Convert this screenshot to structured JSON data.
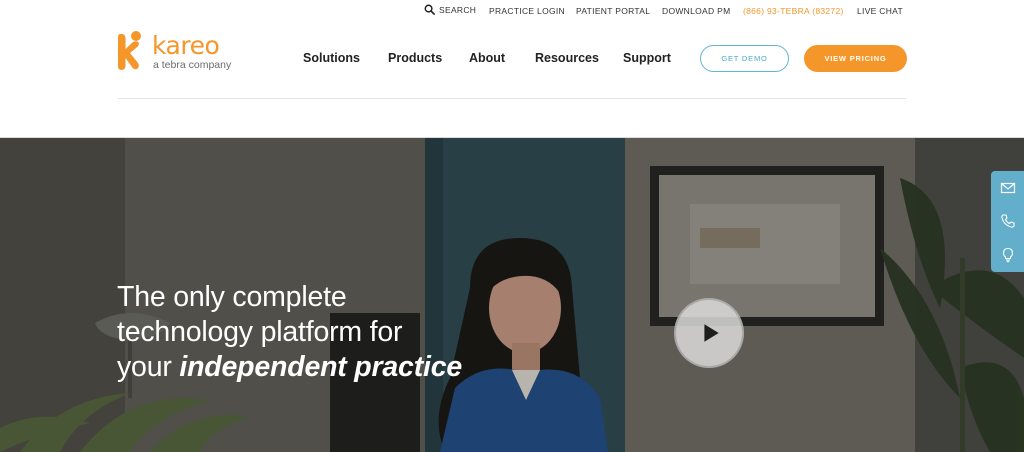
{
  "utility_bar": {
    "search": "SEARCH",
    "practice_login": "PRACTICE LOGIN",
    "patient_portal": "PATIENT PORTAL",
    "download_pm": "DOWNLOAD PM",
    "phone": "(866) 93-TEBRA (83272)",
    "live_chat": "LIVE CHAT"
  },
  "logo": {
    "wordmark": "kareo",
    "tagline": "a tebra company"
  },
  "nav": {
    "items": [
      "Solutions",
      "Products",
      "About",
      "Resources",
      "Support"
    ],
    "get_demo": "GET DEMO",
    "view_pricing": "VIEW PRICING"
  },
  "hero": {
    "title_line1": "The only complete",
    "title_line2": "technology platform for",
    "title_line3_plain": "your ",
    "title_line3_emphasis": "independent practice"
  },
  "side_widget": {
    "icons": [
      "mail-icon",
      "phone-icon",
      "lightbulb-icon"
    ]
  },
  "colors": {
    "brand_orange": "#f5962b",
    "accent_blue": "#62aecb",
    "text_dark": "#222222"
  }
}
